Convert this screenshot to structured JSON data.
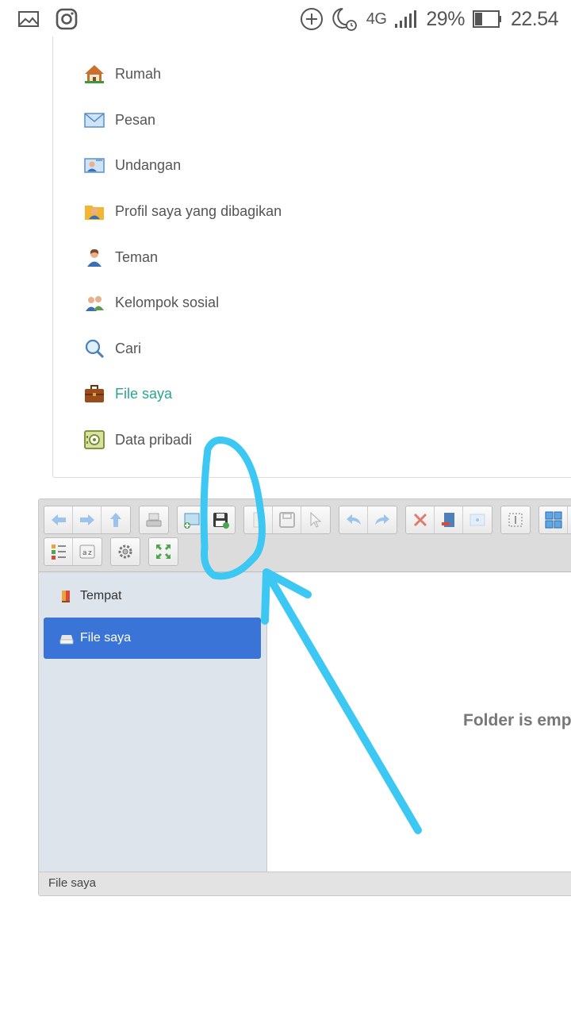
{
  "status_bar": {
    "icons": [
      "gallery-icon",
      "instagram-icon",
      "add-circle-icon",
      "moon-alarm-icon",
      "signal-icon",
      "battery-icon"
    ],
    "network": "4G",
    "battery": "29%",
    "time": "22.54"
  },
  "menu": {
    "items": [
      {
        "label": "Rumah",
        "icon": "house-icon"
      },
      {
        "label": "Pesan",
        "icon": "envelope-icon"
      },
      {
        "label": "Undangan",
        "icon": "invitation-icon"
      },
      {
        "label": "Profil saya yang dibagikan",
        "icon": "shared-profile-icon"
      },
      {
        "label": "Teman",
        "icon": "person-icon"
      },
      {
        "label": "Kelompok sosial",
        "icon": "group-icon"
      },
      {
        "label": "Cari",
        "icon": "magnifier-icon"
      },
      {
        "label": "File saya",
        "icon": "briefcase-icon",
        "active": true
      },
      {
        "label": "Data pribadi",
        "icon": "safe-icon"
      }
    ],
    "active_color": "#2aa58f"
  },
  "file_manager": {
    "sidebar": {
      "items": [
        {
          "label": "Tempat",
          "icon": "places-icon"
        },
        {
          "label": "File saya",
          "icon": "drive-icon",
          "selected": true
        }
      ]
    },
    "empty_message": "Folder is emp",
    "status": "File saya",
    "selected_color": "#3a74d6"
  },
  "annotation": {
    "color": "#3cc8f2"
  }
}
